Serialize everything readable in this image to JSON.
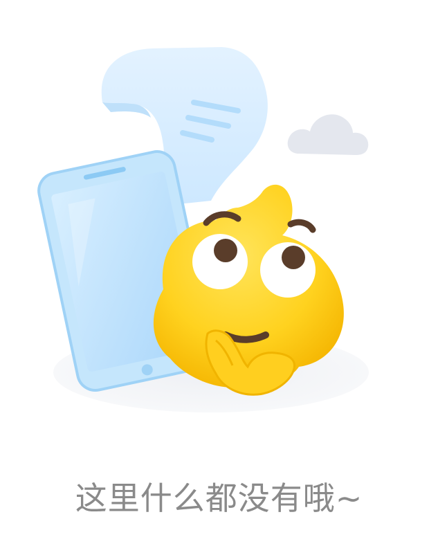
{
  "empty_state": {
    "message": "这里什么都没有哦~",
    "illustration_icon": "confused-mascot-empty-icon",
    "colors": {
      "text": "#8a8a8a",
      "mascot": "#ffcf1f",
      "phone": "#bfe4fb",
      "cloud": "#e6e8ee"
    }
  }
}
